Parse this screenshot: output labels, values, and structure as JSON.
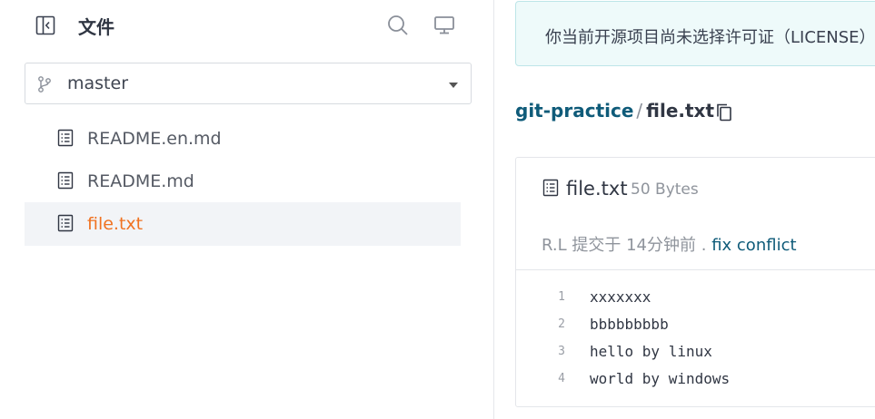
{
  "sidebar": {
    "title": "文件",
    "branch": {
      "label": "master"
    },
    "files": [
      {
        "name": "README.en.md",
        "active": false
      },
      {
        "name": "README.md",
        "active": false
      },
      {
        "name": "file.txt",
        "active": true
      }
    ]
  },
  "notice": {
    "text": "你当前开源项目尚未选择许可证（LICENSE）"
  },
  "breadcrumb": {
    "repo": "git-practice",
    "separator": "/",
    "file": "file.txt"
  },
  "file_view": {
    "name": "file.txt",
    "size": "50 Bytes",
    "commit": {
      "author": "R.L",
      "action": "提交于",
      "time": "14分钟前",
      "dot": ".",
      "message": "fix conflict"
    },
    "lines": [
      {
        "num": "1",
        "text": "xxxxxxx"
      },
      {
        "num": "2",
        "text": "bbbbbbbbb"
      },
      {
        "num": "3",
        "text": "hello by linux"
      },
      {
        "num": "4",
        "text": "world by windows"
      }
    ]
  },
  "colors": {
    "active_file": "#f07221",
    "link": "#0f5b79",
    "notice_bg": "#eefafa"
  }
}
